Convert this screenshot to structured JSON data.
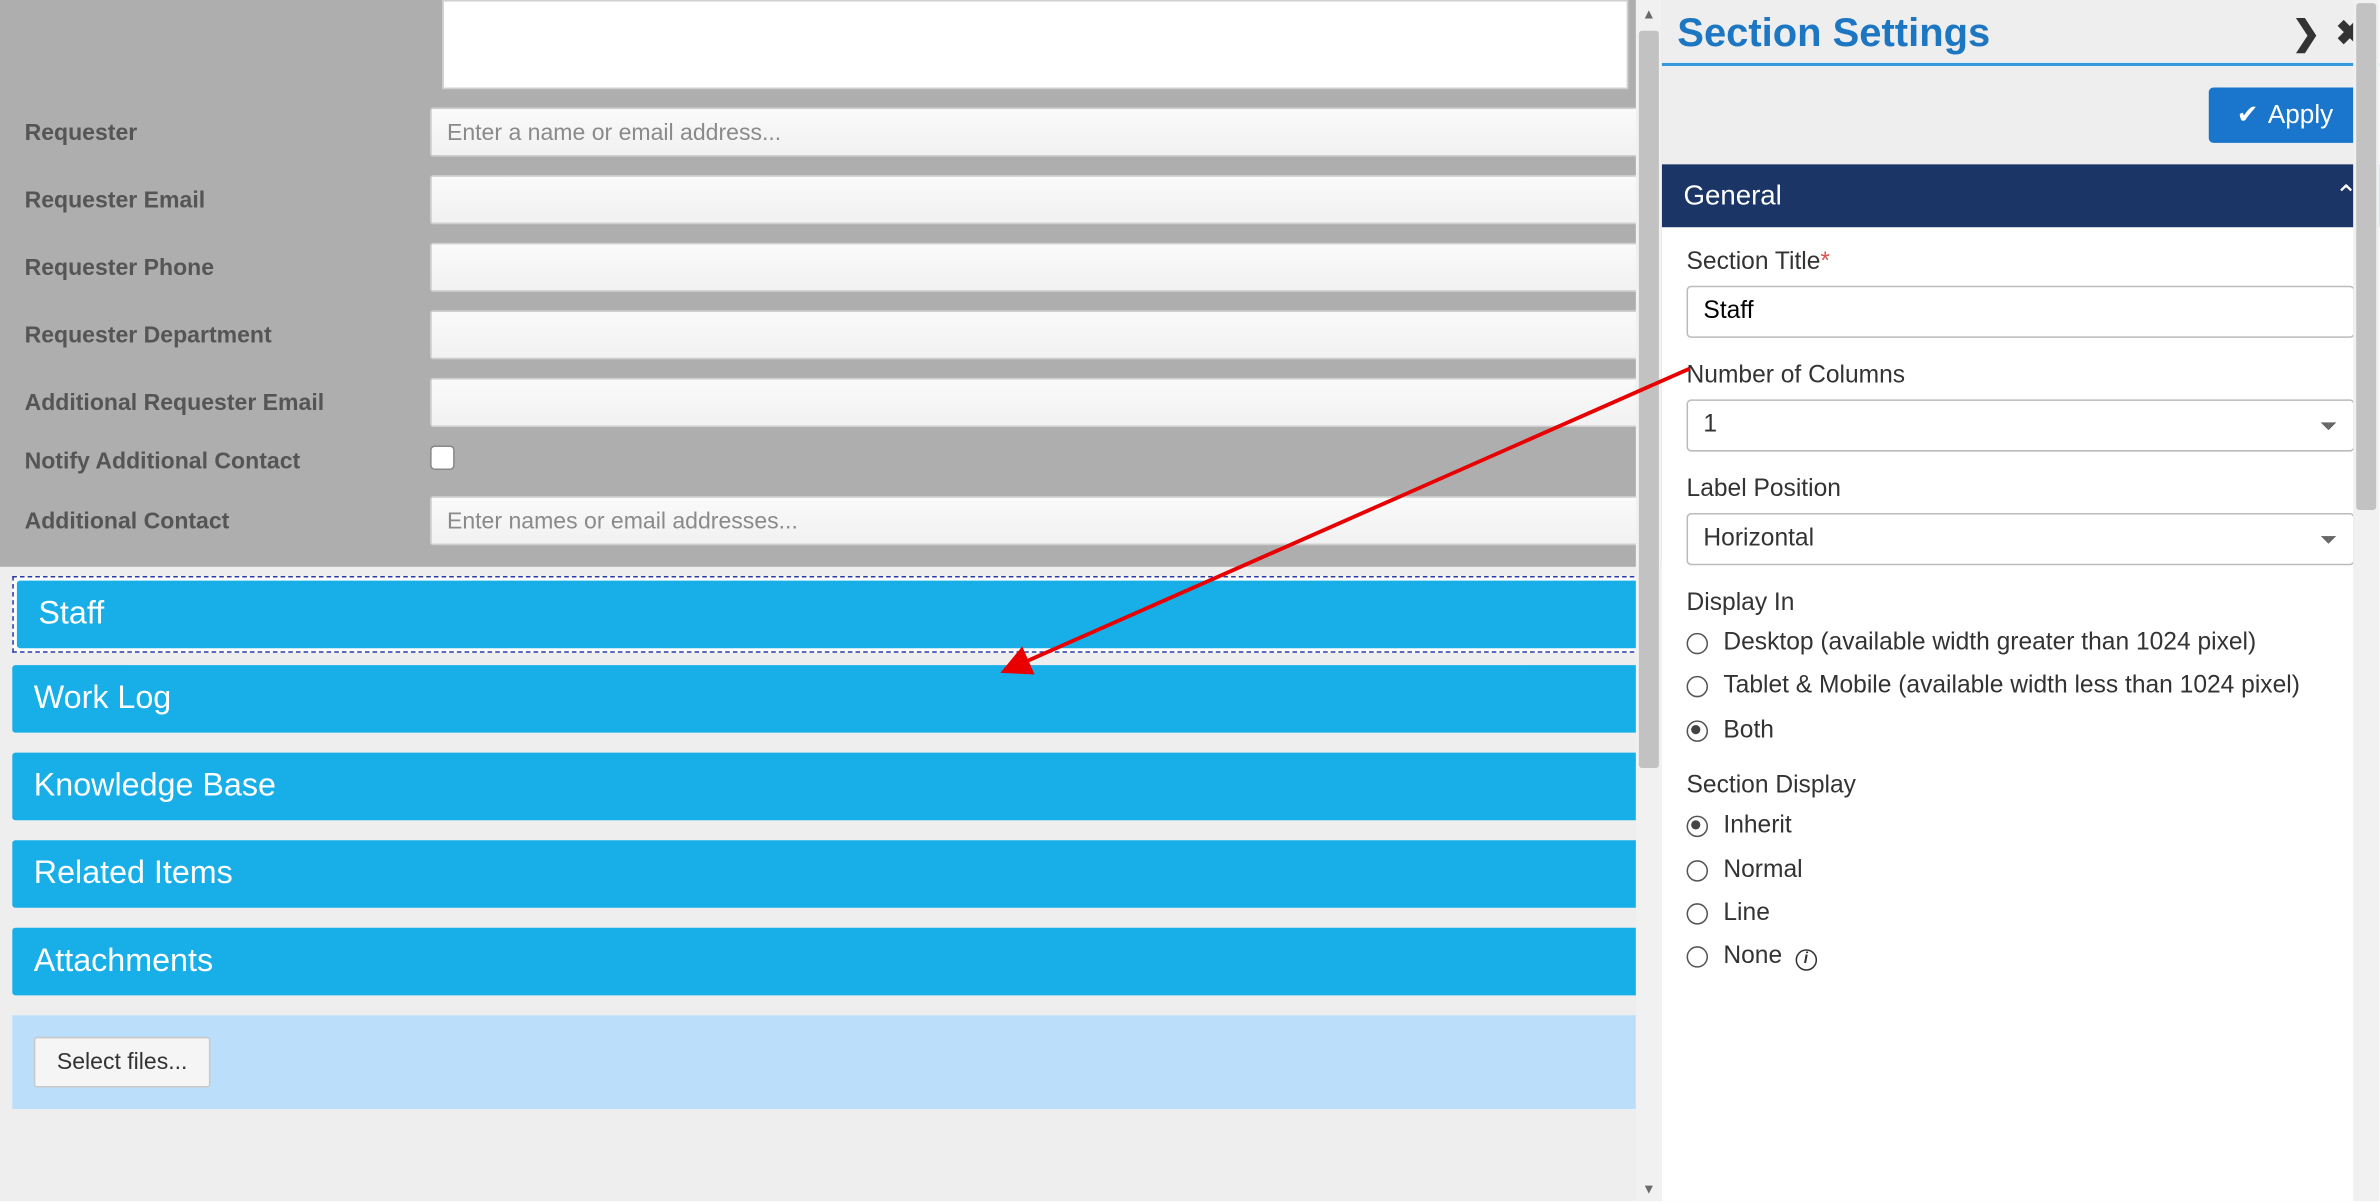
{
  "form": {
    "requester_label": "Requester",
    "requester_placeholder": "Enter a name or email address...",
    "requester_email_label": "Requester Email",
    "requester_phone_label": "Requester Phone",
    "requester_dept_label": "Requester Department",
    "add_email_label": "Additional Requester Email",
    "notify_label": "Notify Additional Contact",
    "add_contact_label": "Additional Contact",
    "add_contact_placeholder": "Enter names or email addresses..."
  },
  "sections": {
    "staff": "Staff",
    "worklog": "Work Log",
    "kb": "Knowledge Base",
    "related": "Related Items",
    "attachments": "Attachments"
  },
  "attach": {
    "select_files": "Select files..."
  },
  "settings": {
    "panel_title": "Section Settings",
    "apply": "Apply",
    "general": "General",
    "section_title_label": "Section Title",
    "section_title_value": "Staff",
    "num_columns_label": "Number of Columns",
    "num_columns_value": "1",
    "label_pos_label": "Label Position",
    "label_pos_value": "Horizontal",
    "display_in_label": "Display In",
    "display_in_desktop": "Desktop (available width greater than 1024 pixel)",
    "display_in_tablet": "Tablet & Mobile (available width less than 1024 pixel)",
    "display_in_both": "Both",
    "section_display_label": "Section Display",
    "sd_inherit": "Inherit",
    "sd_normal": "Normal",
    "sd_line": "Line",
    "sd_none": "None"
  }
}
